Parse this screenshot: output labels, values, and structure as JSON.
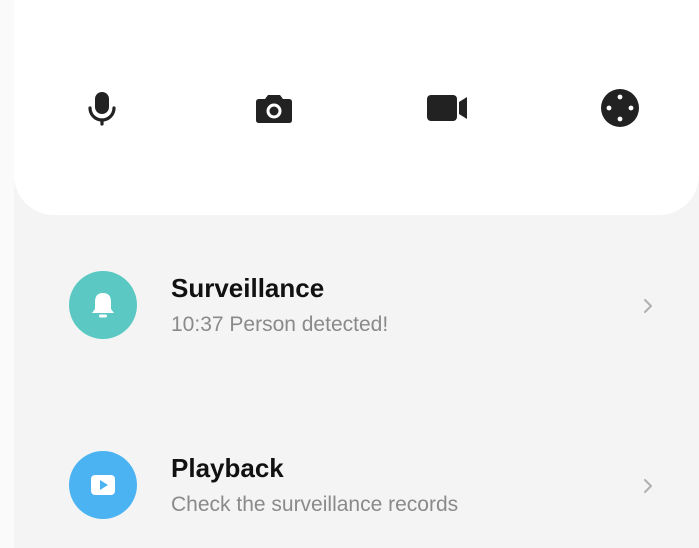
{
  "colors": {
    "card_background": "#ffffff",
    "page_background": "#f4f4f4",
    "icon_dark": "#222222",
    "surveillance_icon_bg": "#5bc8c3",
    "playback_icon_bg": "#4cb3f2",
    "title_text": "#111111",
    "subtitle_text": "#8a8a8a"
  },
  "controls": [
    {
      "name": "microphone",
      "icon": "microphone-icon"
    },
    {
      "name": "snapshot",
      "icon": "camera-icon"
    },
    {
      "name": "record",
      "icon": "video-camera-icon"
    },
    {
      "name": "direction",
      "icon": "direction-pad-icon"
    }
  ],
  "items": [
    {
      "title": "Surveillance",
      "subtitle": "10:37 Person detected!",
      "icon": "bell-icon",
      "trailing_icon": "chevron-right-icon"
    },
    {
      "title": "Playback",
      "subtitle": "Check the surveillance records",
      "icon": "play-icon",
      "trailing_icon": "chevron-right-icon"
    }
  ]
}
